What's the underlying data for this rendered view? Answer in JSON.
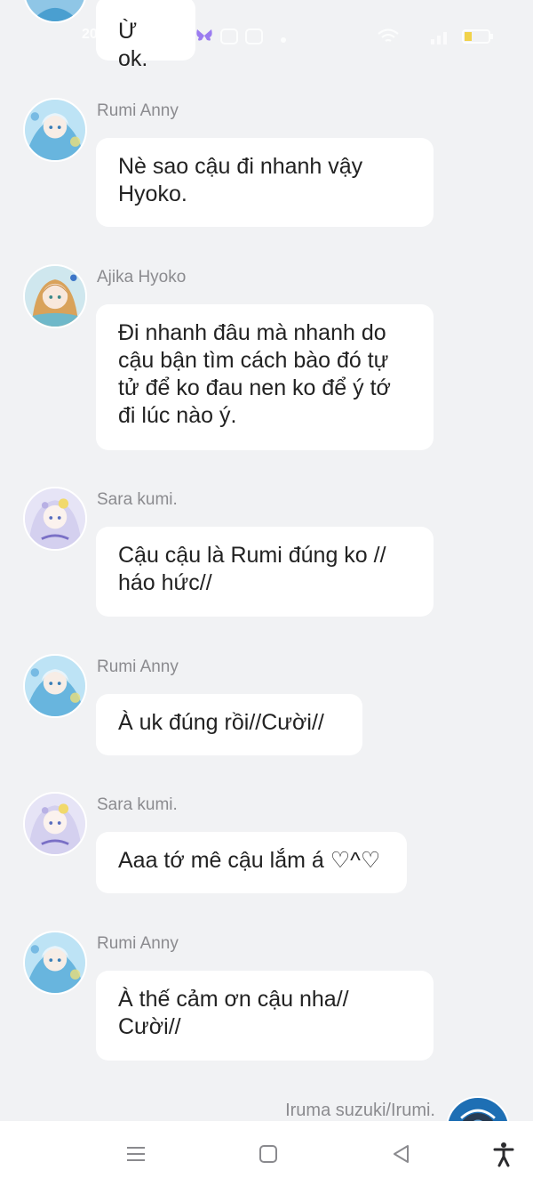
{
  "status_bar": {
    "time_partial": "20",
    "icons": [
      "butterfly-icon",
      "app-icon",
      "app-icon",
      "dot-icon",
      "wifi-icon",
      "signal-icon",
      "battery-icon"
    ]
  },
  "top_bubble": {
    "text": "Ừ ok."
  },
  "messages": [
    {
      "sender": "Rumi Anny",
      "avatar": "rumi-avatar",
      "text": "Nè sao cậu đi nhanh vậy\nHyoko."
    },
    {
      "sender": "Ajika Hyoko",
      "avatar": "ajika-avatar",
      "text": "Đi nhanh đâu mà nhanh do\ncậu bận tìm cách bào đó tự\ntử để ko đau nen ko để ý tớ\nđi lúc nào ý."
    },
    {
      "sender": "Sara kumi.",
      "avatar": "sara-avatar",
      "text": "Cậu cậu là Rumi đúng ko //\nháo hức//"
    },
    {
      "sender": "Rumi Anny",
      "avatar": "rumi-avatar",
      "text": "À uk đúng rồi//Cười//"
    },
    {
      "sender": "Sara kumi.",
      "avatar": "sara-avatar",
      "text": "Aaa tớ mê cậu lắm á ♡^♡"
    },
    {
      "sender": "Rumi Anny",
      "avatar": "rumi-avatar",
      "text": "À thế cảm ơn cậu nha//\nCười//"
    }
  ],
  "last_sender": {
    "name": "Iruma suzuki/Irumi.",
    "avatar": "iruma-avatar"
  },
  "nav_bar": {
    "buttons": [
      "menu-icon",
      "home-icon",
      "back-icon",
      "accessibility-icon"
    ]
  },
  "colors": {
    "background": "#f1f2f4",
    "bubble": "#ffffff",
    "name_text": "#8b8b8f",
    "message_text": "#222222"
  }
}
